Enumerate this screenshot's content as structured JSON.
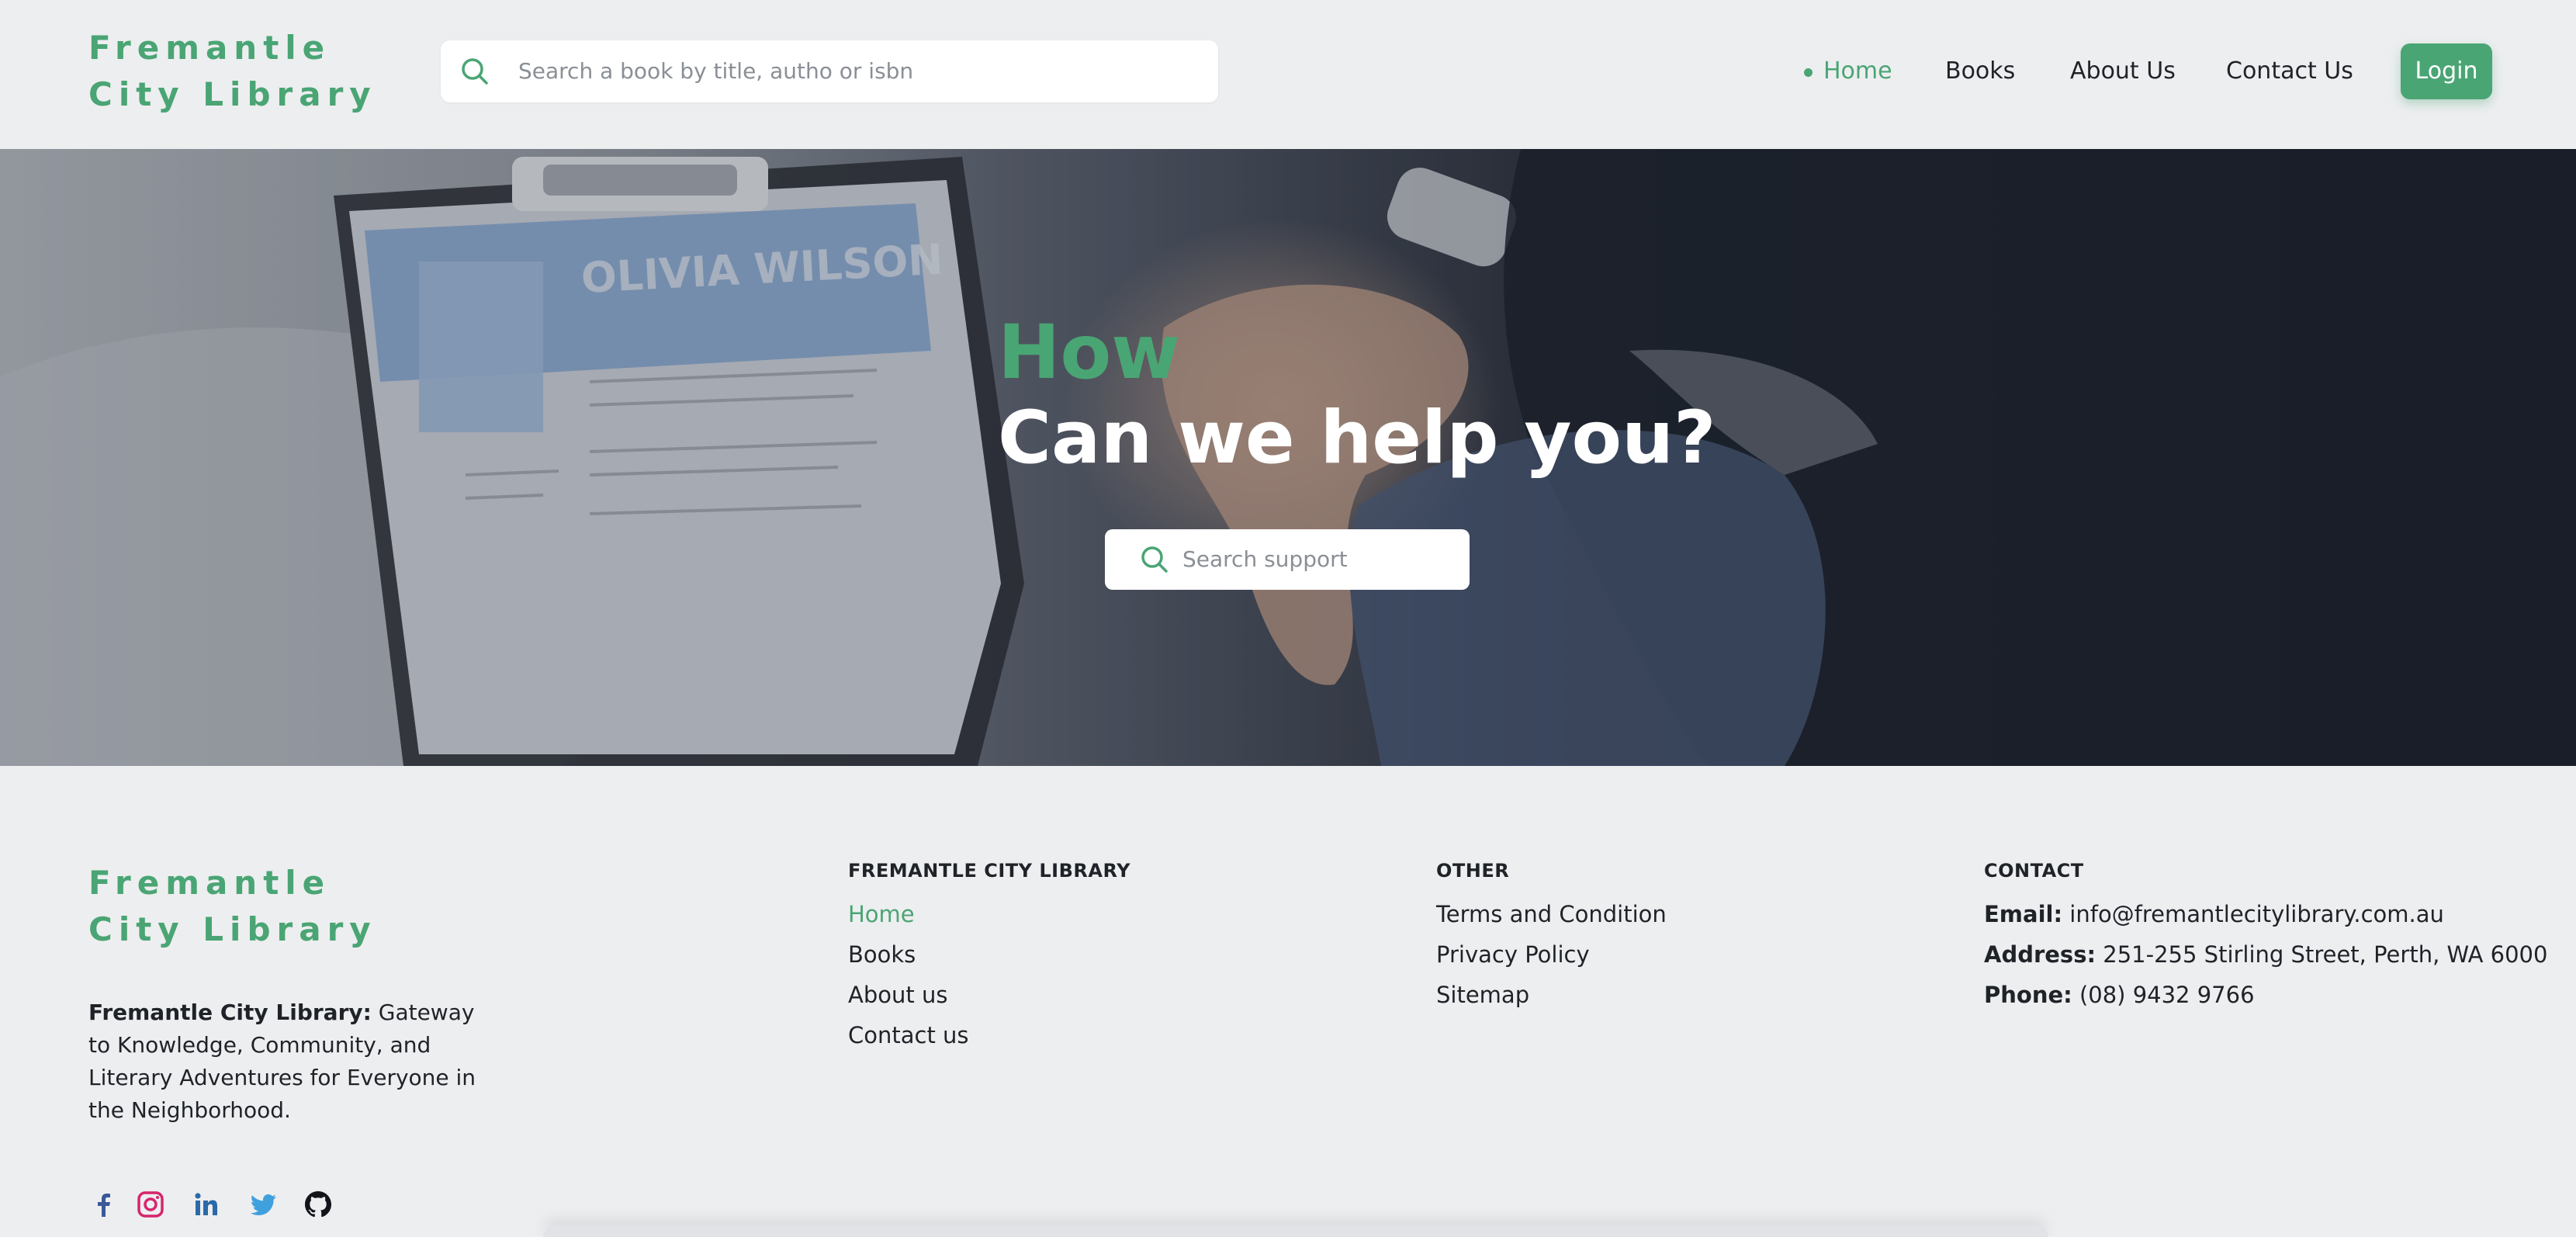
{
  "header": {
    "brand": "Fremantle City Library",
    "search_placeholder": "Search a book by title, autho or isbn",
    "nav": [
      {
        "label": "Home",
        "active": true
      },
      {
        "label": "Books",
        "active": false
      },
      {
        "label": "About Us",
        "active": false
      },
      {
        "label": "Contact Us",
        "active": false
      }
    ],
    "login_label": "Login"
  },
  "hero": {
    "title_accent": "How",
    "title_main": "Can we help you?",
    "search_placeholder": "Search support",
    "image_text": "OLIVIA WILSON"
  },
  "footer": {
    "brand": "Fremantle City Library",
    "desc_bold": "Fremantle City Library:",
    "desc_text": " Gateway to Knowledge, Community, and Literary Adventures for Everyone in the Neighborhood.",
    "columns": {
      "library": {
        "heading": "FREMANTLE CITY LIBRARY",
        "links": [
          {
            "label": "Home",
            "active": true
          },
          {
            "label": "Books",
            "active": false
          },
          {
            "label": "About us",
            "active": false
          },
          {
            "label": "Contact us",
            "active": false
          }
        ]
      },
      "other": {
        "heading": "OTHER",
        "links": [
          "Terms and Condition",
          "Privacy Policy",
          "Sitemap"
        ]
      },
      "contact": {
        "heading": "CONTACT",
        "email_label": "Email:",
        "email": " info@fremantlecitylibrary.com.au",
        "address_label": "Address:",
        "address": " 251-255 Stirling Street, Perth, WA 6000",
        "phone_label": "Phone:",
        "phone": " (08) 9432 9766"
      }
    },
    "social": [
      "facebook-icon",
      "instagram-icon",
      "linkedin-icon",
      "twitter-icon",
      "github-icon"
    ]
  },
  "colors": {
    "accent": "#4aa574",
    "background": "#edeef0",
    "text": "#1f2328"
  }
}
